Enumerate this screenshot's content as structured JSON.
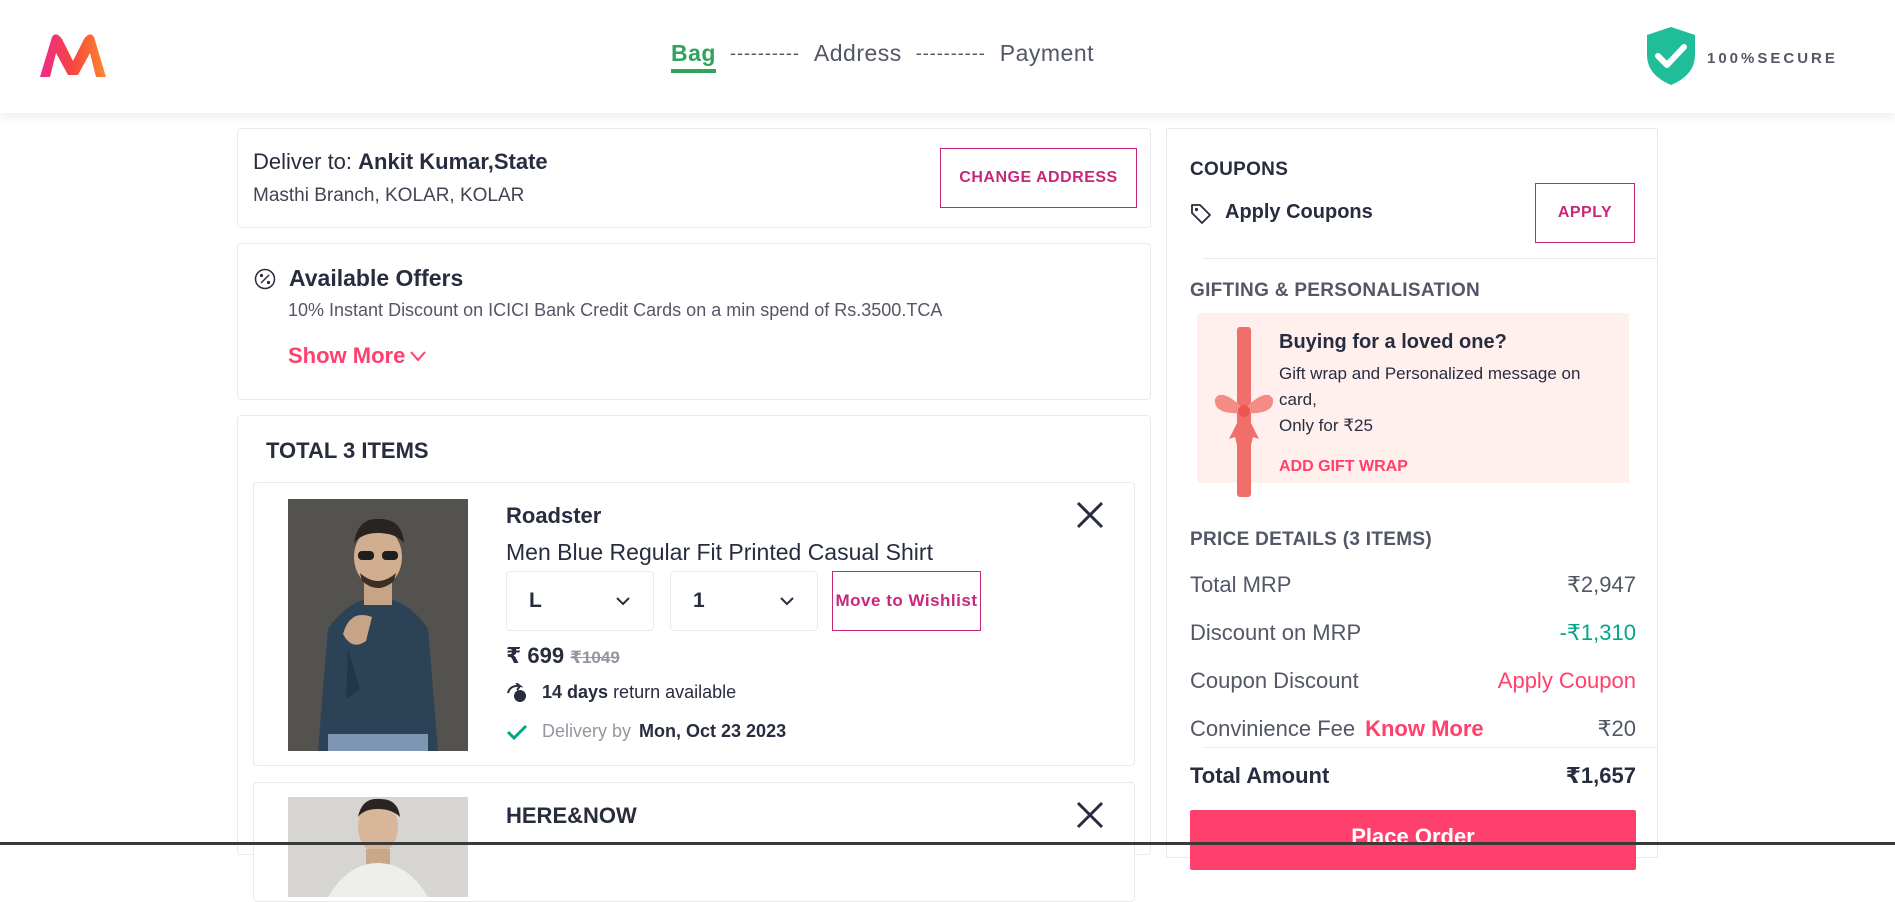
{
  "header": {
    "logo": "myntra-logo",
    "steps": [
      {
        "label": "Bag",
        "active": true
      },
      {
        "label": "Address",
        "active": false
      },
      {
        "label": "Payment",
        "active": false
      }
    ],
    "step_separator": "----------",
    "secure_label": "100%SECURE",
    "secure_icon": "shield-check-icon"
  },
  "address": {
    "deliver_prefix": "Deliver to:",
    "name": "Ankit Kumar,State",
    "line": "Masthi Branch, KOLAR, KOLAR",
    "change_label": "CHANGE ADDRESS"
  },
  "offers": {
    "title": "Available Offers",
    "text": "10% Instant Discount on ICICI Bank Credit Cards on a min spend of Rs.3500.TCA",
    "show_more": "Show More"
  },
  "bag": {
    "title": "TOTAL 3 ITEMS",
    "items": [
      {
        "brand": "Roadster",
        "name": "Men Blue Regular Fit Printed Casual Shirt",
        "size": "L",
        "qty": "1",
        "wishlist_label": "Move to Wishlist",
        "price": "₹ 699",
        "mrp": "₹1049",
        "return_days": "14 days",
        "return_text": "return available",
        "delivery_label": "Delivery by",
        "delivery_date": "Mon, Oct 23 2023"
      },
      {
        "brand": "HERE&NOW"
      }
    ]
  },
  "coupons": {
    "heading": "COUPONS",
    "apply_text": "Apply Coupons",
    "apply_btn": "APPLY"
  },
  "gifting": {
    "heading": "GIFTING & PERSONALISATION",
    "title": "Buying for a loved one?",
    "desc": "Gift wrap and Personalized message on card,",
    "price_text": "Only for ₹25",
    "link": "ADD GIFT WRAP"
  },
  "price_details": {
    "heading": "PRICE DETAILS (3 ITEMS)",
    "rows": [
      {
        "label": "Total MRP",
        "value": "₹2,947"
      },
      {
        "label": "Discount on MRP",
        "value": "-₹1,310"
      },
      {
        "label": "Coupon Discount",
        "value": "Apply Coupon"
      },
      {
        "label": "Convinience Fee",
        "extra": "Know More",
        "value": "₹20"
      }
    ],
    "total_label": "Total Amount",
    "total_value": "₹1,657",
    "place_order": "Place Order"
  },
  "colors": {
    "brand_pink": "#ff3f6c",
    "accent_magenta": "#c7277a",
    "step_active_green": "#30a45c",
    "discount_green": "#03a685",
    "secure_teal": "#20bd99"
  }
}
